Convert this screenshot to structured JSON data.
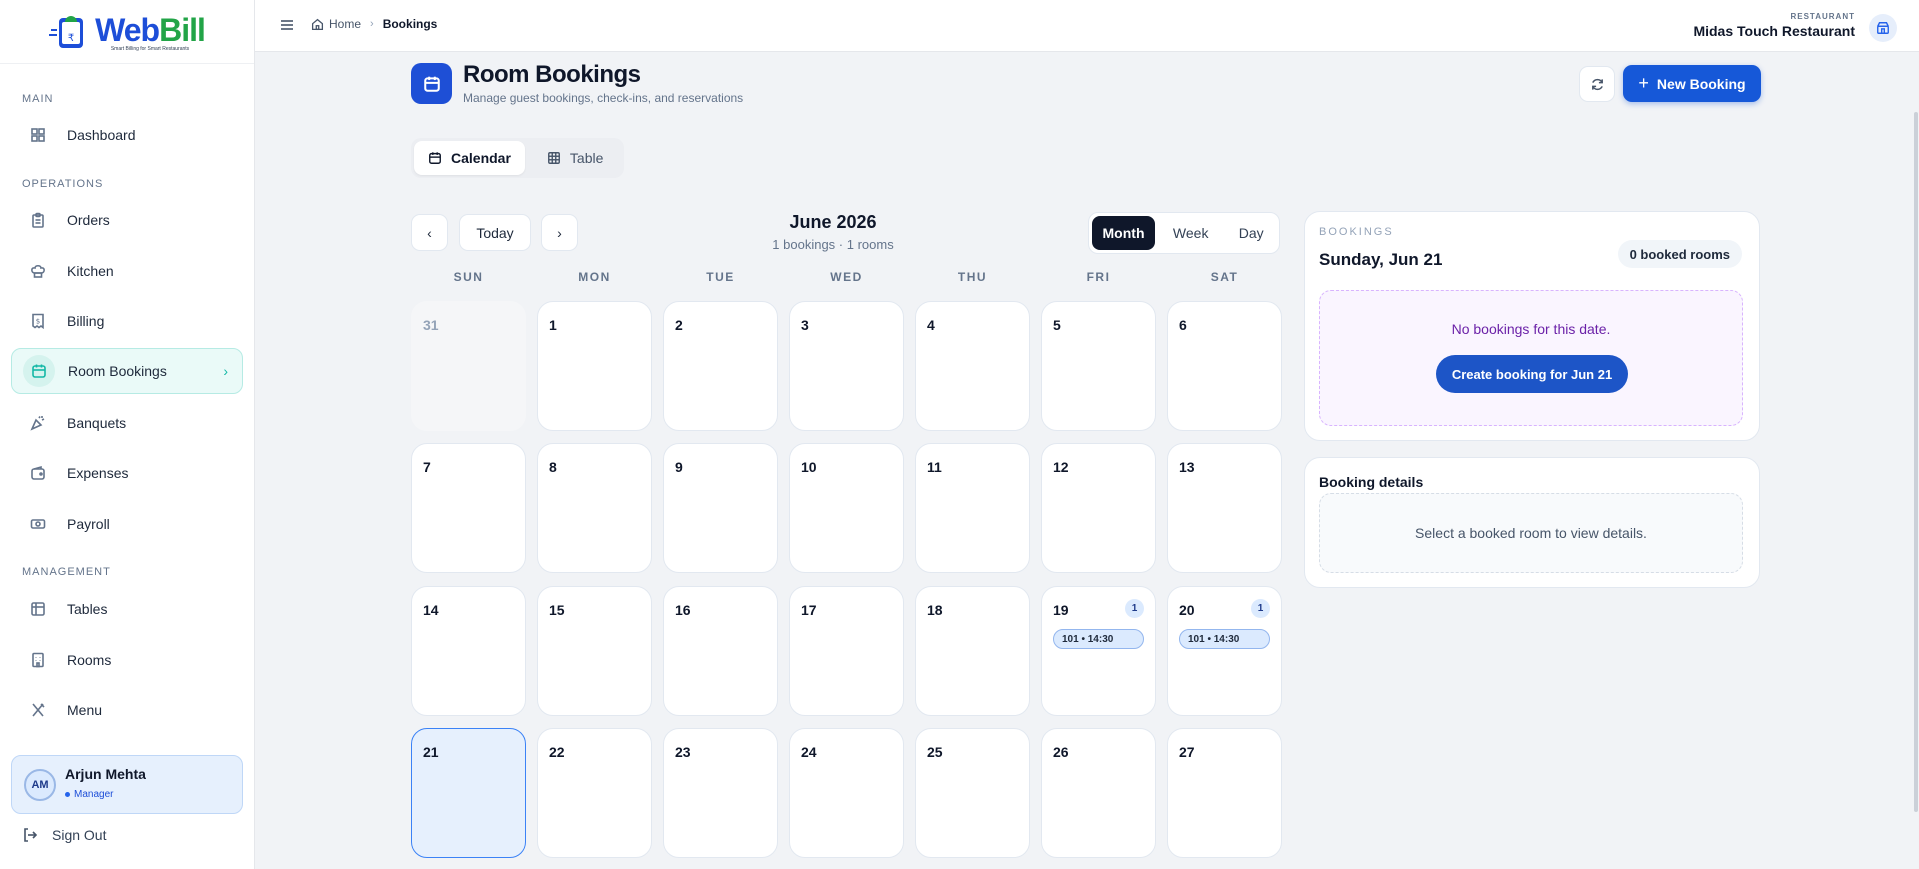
{
  "app": {
    "logo_text_a": "Web",
    "logo_text_b": "Bill",
    "logo_tagline": "Smart Billing for Smart Restaurants"
  },
  "sidebar": {
    "sections": {
      "main": "MAIN",
      "operations": "OPERATIONS",
      "management": "MANAGEMENT"
    },
    "items": [
      {
        "label": "Dashboard",
        "icon": "grid-icon"
      },
      {
        "label": "Orders",
        "icon": "clipboard-icon"
      },
      {
        "label": "Kitchen",
        "icon": "chef-hat-icon"
      },
      {
        "label": "Billing",
        "icon": "receipt-icon"
      },
      {
        "label": "Room Bookings",
        "icon": "calendar-icon",
        "active": true
      },
      {
        "label": "Banquets",
        "icon": "party-icon"
      },
      {
        "label": "Expenses",
        "icon": "wallet-icon"
      },
      {
        "label": "Payroll",
        "icon": "banknote-icon"
      },
      {
        "label": "Tables",
        "icon": "table-icon"
      },
      {
        "label": "Rooms",
        "icon": "building-icon"
      },
      {
        "label": "Menu",
        "icon": "utensils-icon"
      }
    ],
    "user": {
      "initials": "AM",
      "name": "Arjun Mehta",
      "role": "Manager"
    },
    "sign_out": "Sign Out"
  },
  "topbar": {
    "breadcrumb_home": "Home",
    "breadcrumb_current": "Bookings",
    "restaurant_label": "RESTAURANT",
    "restaurant_name": "Midas Touch Restaurant"
  },
  "page": {
    "title": "Room Bookings",
    "subtitle": "Manage guest bookings, check-ins, and reservations",
    "new_booking": "New Booking"
  },
  "views": {
    "calendar": "Calendar",
    "table": "Table"
  },
  "calendar": {
    "today_label": "Today",
    "month_title": "June 2026",
    "summary": "1 bookings · 1 rooms",
    "modes": [
      "Month",
      "Week",
      "Day"
    ],
    "active_mode": "Month",
    "weekdays": [
      "SUN",
      "MON",
      "TUE",
      "WED",
      "THU",
      "FRI",
      "SAT"
    ],
    "weeks": [
      [
        {
          "d": "31",
          "outside": true
        },
        {
          "d": "1"
        },
        {
          "d": "2"
        },
        {
          "d": "3"
        },
        {
          "d": "4"
        },
        {
          "d": "5"
        },
        {
          "d": "6"
        }
      ],
      [
        {
          "d": "7"
        },
        {
          "d": "8"
        },
        {
          "d": "9"
        },
        {
          "d": "10"
        },
        {
          "d": "11"
        },
        {
          "d": "12"
        },
        {
          "d": "13"
        }
      ],
      [
        {
          "d": "14"
        },
        {
          "d": "15"
        },
        {
          "d": "16"
        },
        {
          "d": "17"
        },
        {
          "d": "18"
        },
        {
          "d": "19",
          "count": "1",
          "booking": "101 • 14:30"
        },
        {
          "d": "20",
          "count": "1",
          "booking": "101 • 14:30"
        }
      ],
      [
        {
          "d": "21",
          "selected": true
        },
        {
          "d": "22"
        },
        {
          "d": "23"
        },
        {
          "d": "24"
        },
        {
          "d": "25"
        },
        {
          "d": "26"
        },
        {
          "d": "27"
        }
      ]
    ]
  },
  "panel": {
    "label": "BOOKINGS",
    "date": "Sunday, Jun 21",
    "badge": "0 booked rooms",
    "empty_text": "No bookings for this date.",
    "create_button": "Create booking for Jun 21",
    "details_title": "Booking details",
    "details_empty": "Select a booked room to view details."
  },
  "colors": {
    "accent": "#1658d8",
    "active_nav": "#14b8a6",
    "selected_day": "#e6f0fd"
  }
}
